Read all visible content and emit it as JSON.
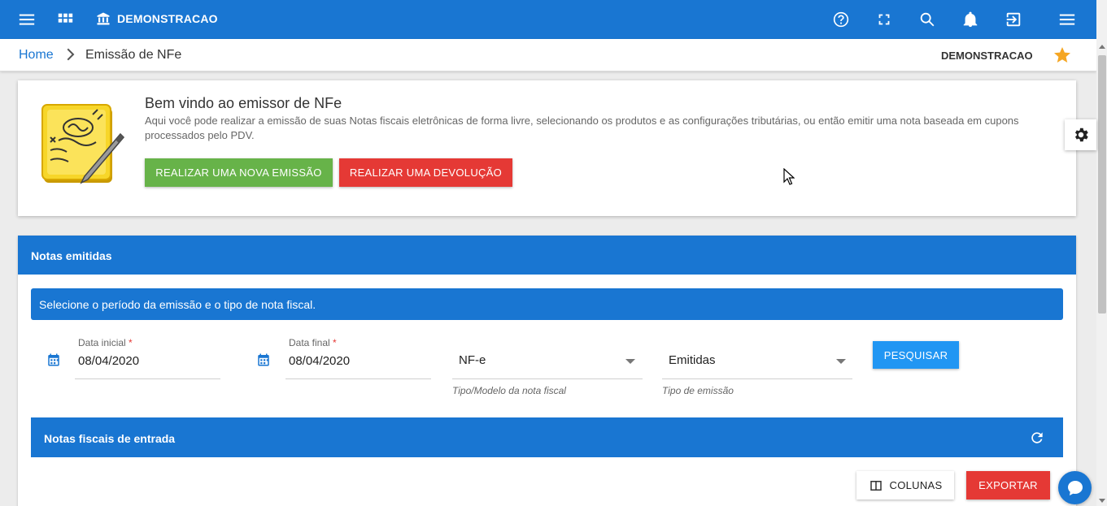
{
  "topbar": {
    "company": "DEMONSTRACAO",
    "icons": [
      "menu-icon",
      "apps-grid-icon",
      "bank-icon",
      "help-icon",
      "fullscreen-icon",
      "search-icon",
      "notifications-icon",
      "exit-icon",
      "menu-right-icon"
    ]
  },
  "breadcrumb": {
    "home": "Home",
    "current": "Emissão de NFe",
    "company": "DEMONSTRACAO"
  },
  "welcome": {
    "title": "Bem vindo ao emissor de NFe",
    "description": "Aqui você pode realizar a emissão de suas Notas fiscais eletrônicas de forma livre, selecionando os produtos e as configurações tributárias, ou então emitir uma nota baseada em cupons processados pelo PDV.",
    "new_emission": "REALIZAR UMA NOVA EMISSÃO",
    "devolution": "REALIZAR UMA DEVOLUÇÃO"
  },
  "notas": {
    "title": "Notas emitidas",
    "info": "Selecione o período da emissão e o tipo de nota fiscal.",
    "start_label": "Data inicial",
    "start_value": "08/04/2020",
    "end_label": "Data final",
    "end_value": "08/04/2020",
    "required_mark": "*",
    "model_value": "NF-e",
    "model_hint": "Tipo/Modelo da nota fiscal",
    "type_value": "Emitidas",
    "type_hint": "Tipo de emissão",
    "search": "PESQUISAR"
  },
  "entrada": {
    "title": "Notas fiscais de entrada",
    "columns": "COLUNAS",
    "export": "EXPORTAR"
  },
  "colors": {
    "primary": "#1976d2",
    "green": "#67b349",
    "red": "#e53935",
    "star": "#f5a623"
  }
}
